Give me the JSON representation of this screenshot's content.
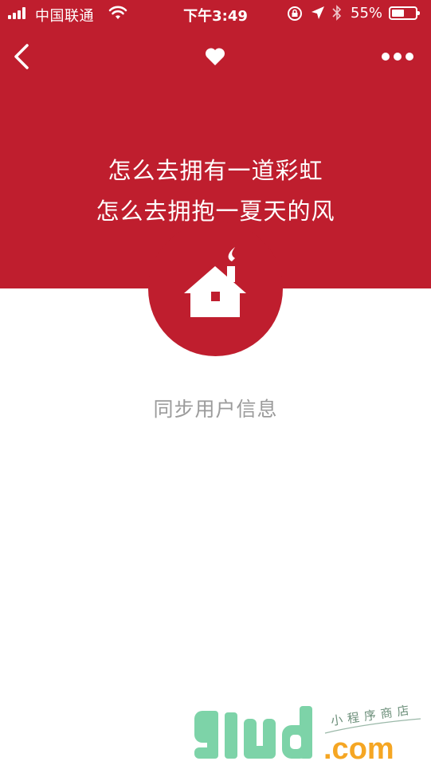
{
  "status_bar": {
    "carrier": "中国联通",
    "time": "下午3:49",
    "battery_percent": "55%",
    "battery_level": 0.55,
    "icons": [
      "signal-icon",
      "wifi-icon",
      "rotation-lock-icon",
      "location-arrow-icon",
      "bluetooth-icon",
      "battery-icon"
    ]
  },
  "nav": {
    "icons": [
      "back-arrow-icon",
      "heart-icon",
      "more-dots-icon"
    ]
  },
  "hero": {
    "line1": "怎么去拥有一道彩虹",
    "line2": "怎么去拥抱一夏天的风",
    "icon": "house-icon"
  },
  "main": {
    "sync_label": "同步用户信息"
  },
  "watermark": {
    "brand": "glud",
    "domain": ".com",
    "tagline": "小程序商店"
  },
  "colors": {
    "primary_red": "#bf1e2e",
    "text_gray": "#9b9b9b",
    "brand_green": "#7dd3a8",
    "brand_orange": "#f5a623"
  }
}
